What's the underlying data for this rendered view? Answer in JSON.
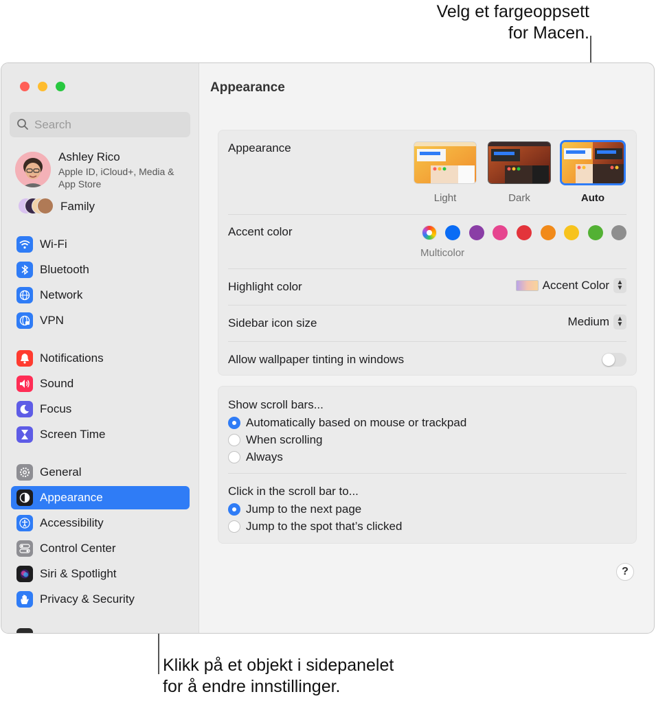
{
  "callouts": {
    "top_line1": "Velg et fargeoppsett",
    "top_line2": "for Macen.",
    "bottom_line1": "Klikk på et objekt i sidepanelet",
    "bottom_line2": "for å endre innstillinger."
  },
  "sidebar": {
    "search_placeholder": "Search",
    "profile": {
      "name": "Ashley Rico",
      "subtitle": "Apple ID, iCloud+, Media & App Store"
    },
    "family_label": "Family",
    "items": [
      {
        "label": "Wi-Fi",
        "icon": "wifi-icon",
        "color": "#2f7cf6"
      },
      {
        "label": "Bluetooth",
        "icon": "bluetooth-icon",
        "color": "#2f7cf6"
      },
      {
        "label": "Network",
        "icon": "globe-icon",
        "color": "#2f7cf6"
      },
      {
        "label": "VPN",
        "icon": "vpn-globe-icon",
        "color": "#2f7cf6"
      },
      {
        "label": "Notifications",
        "icon": "bell-icon",
        "color": "#ff3b30"
      },
      {
        "label": "Sound",
        "icon": "speaker-icon",
        "color": "#ff2d55"
      },
      {
        "label": "Focus",
        "icon": "moon-icon",
        "color": "#5e5ce6"
      },
      {
        "label": "Screen Time",
        "icon": "hourglass-icon",
        "color": "#5e5ce6"
      },
      {
        "label": "General",
        "icon": "gear-icon",
        "color": "#8e8e93"
      },
      {
        "label": "Appearance",
        "icon": "appearance-icon",
        "color": "#1d1d1f"
      },
      {
        "label": "Accessibility",
        "icon": "accessibility-icon",
        "color": "#2f7cf6"
      },
      {
        "label": "Control Center",
        "icon": "control-center-icon",
        "color": "#8e8e93"
      },
      {
        "label": "Siri & Spotlight",
        "icon": "siri-icon",
        "color": "#1d1d1f"
      },
      {
        "label": "Privacy & Security",
        "icon": "hand-icon",
        "color": "#2f7cf6"
      }
    ],
    "selected": "Appearance"
  },
  "main": {
    "title": "Appearance",
    "appearance": {
      "label": "Appearance",
      "options": [
        "Light",
        "Dark",
        "Auto"
      ],
      "selected": "Auto"
    },
    "accent": {
      "label": "Accent color",
      "caption": "Multicolor",
      "colors": [
        "multicolor",
        "#0a6cf5",
        "#8a3ea6",
        "#e6458f",
        "#e3343b",
        "#f18a1a",
        "#f7c31d",
        "#53b134",
        "#8e8e8e"
      ]
    },
    "highlight": {
      "label": "Highlight color",
      "value": "Accent Color"
    },
    "sidebar_icon_size": {
      "label": "Sidebar icon size",
      "value": "Medium"
    },
    "tinting": {
      "label": "Allow wallpaper tinting in windows",
      "enabled": false
    },
    "scroll_bars": {
      "label": "Show scroll bars...",
      "options": [
        "Automatically based on mouse or trackpad",
        "When scrolling",
        "Always"
      ],
      "selected": 0
    },
    "click_scroll": {
      "label": "Click in the scroll bar to...",
      "options": [
        "Jump to the next page",
        "Jump to the spot that’s clicked"
      ],
      "selected": 0
    },
    "help_label": "?"
  }
}
